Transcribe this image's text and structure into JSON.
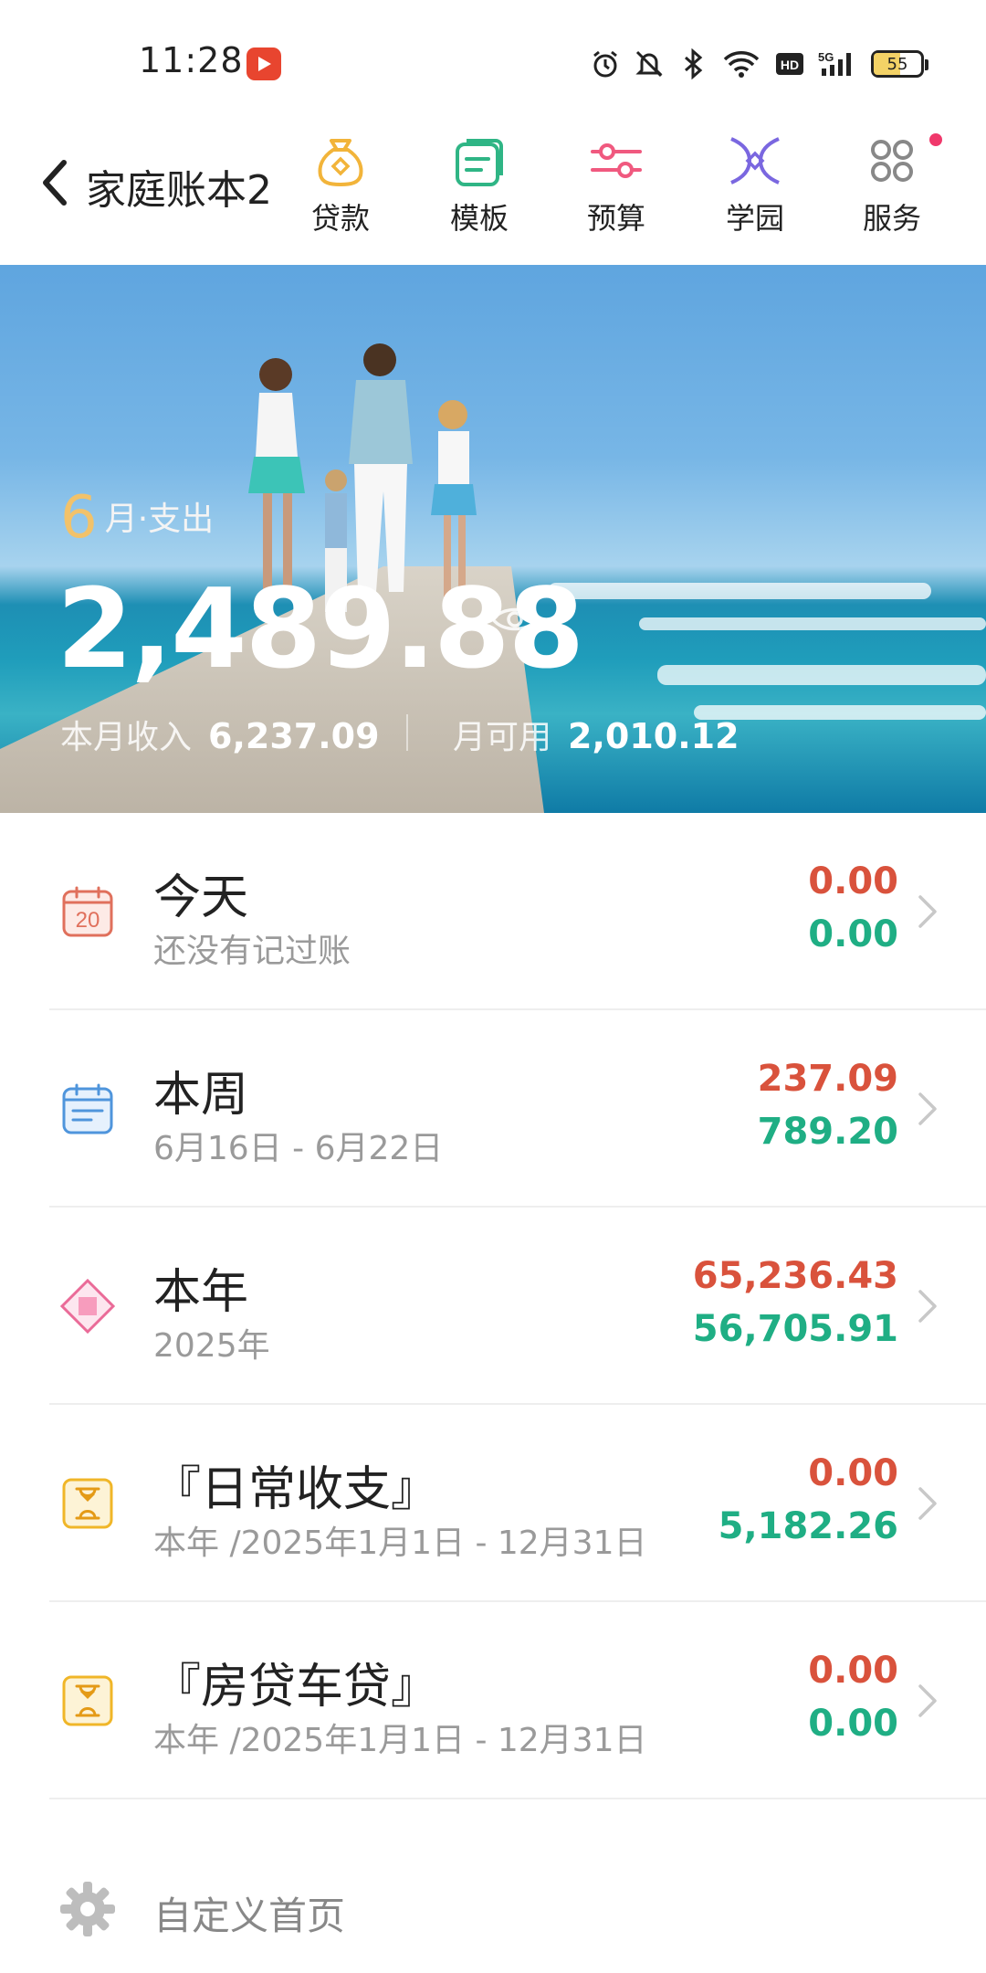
{
  "status_bar": {
    "time": "11:28",
    "battery": "55",
    "icons": [
      "alarm-icon",
      "mute-bell-icon",
      "bluetooth-icon",
      "wifi-icon",
      "hd-icon",
      "5g-signal-icon"
    ]
  },
  "header": {
    "title": "家庭账本2",
    "nav": [
      {
        "label": "贷款",
        "icon": "money-bag-icon",
        "color": "#f2b43a"
      },
      {
        "label": "模板",
        "icon": "template-icon",
        "color": "#2fb585"
      },
      {
        "label": "预算",
        "icon": "budget-sliders-icon",
        "color": "#f0597f"
      },
      {
        "label": "学园",
        "icon": "academy-icon",
        "color": "#7a67e0"
      },
      {
        "label": "服务",
        "icon": "services-grid-icon",
        "color": "#888888"
      }
    ]
  },
  "hero": {
    "month": "6",
    "month_suffix": "月·支出",
    "expense": "2,489.88",
    "income_label": "本月收入",
    "income": "6,237.09",
    "available_label": "月可用",
    "available": "2,010.12"
  },
  "rows": [
    {
      "title": "今天",
      "subtitle": "还没有记过账",
      "expense": "0.00",
      "income": "0.00",
      "icon": "calendar-20-icon",
      "icon_text": "20"
    },
    {
      "title": "本周",
      "subtitle": "6月16日 - 6月22日",
      "expense": "237.09",
      "income": "789.20",
      "icon": "week-calendar-icon"
    },
    {
      "title": "本年",
      "subtitle": "2025年",
      "expense": "65,236.43",
      "income": "56,705.91",
      "icon": "year-diamond-icon"
    },
    {
      "title": "『日常收支』",
      "subtitle": "本年 /2025年1月1日 - 12月31日",
      "expense": "0.00",
      "income": "5,182.26",
      "icon": "hourglass-icon"
    },
    {
      "title": "『房贷车贷』",
      "subtitle": "本年 /2025年1月1日 - 12月31日",
      "expense": "0.00",
      "income": "0.00",
      "icon": "hourglass-icon"
    }
  ],
  "footer": {
    "custom_home": "自定义首页"
  },
  "colors": {
    "expense": "#d9523c",
    "income": "#1fae84",
    "accent_month": "#f2c26a"
  }
}
